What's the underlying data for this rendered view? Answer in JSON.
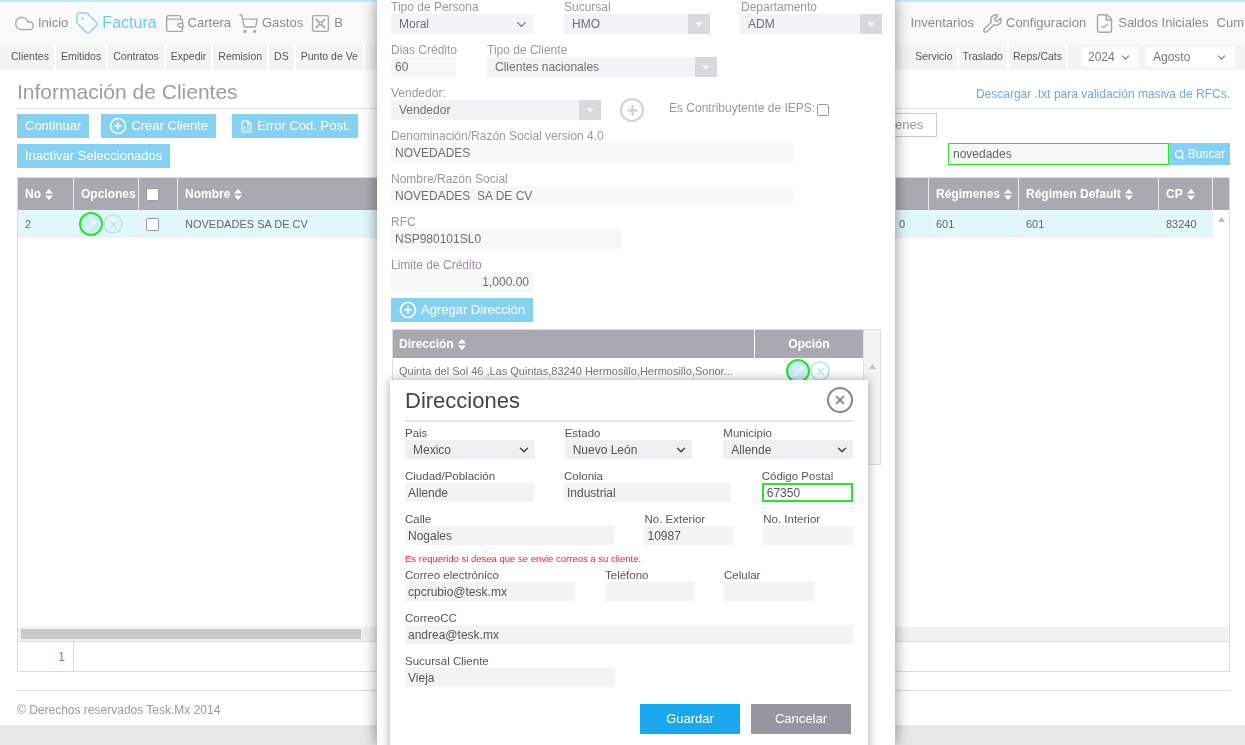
{
  "nav": {
    "left": [
      {
        "label": "Inicio",
        "selected": false
      },
      {
        "label": "Factura",
        "selected": true
      },
      {
        "label": "Cartera",
        "selected": false
      },
      {
        "label": "Gastos",
        "selected": false
      },
      {
        "label": "B",
        "selected": false
      }
    ],
    "right": [
      {
        "label": "Inventarios",
        "selected": false
      },
      {
        "label": "Configuracion",
        "selected": false
      },
      {
        "label": "Saldos Iniciales",
        "selected": false
      },
      {
        "label": "Cum",
        "selected": false
      }
    ]
  },
  "subnav": {
    "left": [
      "Clientes",
      "Emitidos",
      "Contratos",
      "Expedir",
      "Remision",
      "DS",
      "Punto de Ve"
    ],
    "right": [
      "Servicio",
      "Traslado",
      "Reps/Cats"
    ],
    "year": "2024",
    "month": "Agosto"
  },
  "page": {
    "title": "Información de Clientes",
    "download_link": "Descargar .txt para validación masiva de RFCs.",
    "buttons": [
      "Continuar",
      "Crear Cliente",
      "Error Cod. Post."
    ],
    "inactivate_button": "Inactivar Seleccionados",
    "filter_field": "enes",
    "search": {
      "value": "novedades",
      "button": "Buscar"
    }
  },
  "table": {
    "columns": [
      {
        "kind": "sort",
        "label": "No"
      },
      {
        "kind": "text",
        "label": "Opciones"
      },
      {
        "kind": "checkbox",
        "checked": false
      },
      {
        "kind": "sort",
        "label": "Nombre"
      },
      {
        "kind": "hidden"
      },
      {
        "kind": "sort",
        "label": "Régimenes"
      },
      {
        "kind": "sort",
        "label": "Régimen Default"
      },
      {
        "kind": "sort",
        "label": "CP"
      }
    ],
    "rows": [
      {
        "selected": true,
        "no": "2",
        "checked": false,
        "nombre": "NOVEDADES SA DE CV",
        "column_5": "0",
        "regimenes": "601",
        "regimen_default": "601",
        "cp": "83240"
      }
    ],
    "pager": "1"
  },
  "footer": "© Derechos reservados Tesk.Mx 2014",
  "client_form": {
    "row1": [
      {
        "label": "Tipo de Persona",
        "value": "Moral",
        "disabled": false
      },
      {
        "label": "Sucursal",
        "value": "HMO",
        "disabled": true
      },
      {
        "label": "Departamento",
        "value": "ADM",
        "disabled": true
      }
    ],
    "dias_credito": {
      "label": "Dias Crédito",
      "value": "60"
    },
    "tipo_cliente": {
      "label": "Tipo de Cliente",
      "value": "Clientes nacionales",
      "disabled": true
    },
    "vendedor": {
      "label": "Vendedor:",
      "value": "Vendedor",
      "disabled": true
    },
    "ieps": {
      "label": "Es Contribuytente de IEPS:",
      "checked": false
    },
    "fields": [
      {
        "label": "Denominación/Razón Social version 4.0",
        "value": "NOVEDADES"
      },
      {
        "label": "Nombre/Razón Social",
        "value": "NOVEDADES  SA DE CV"
      },
      {
        "label": "RFC",
        "value": "NSP980101SL0"
      }
    ],
    "credit": {
      "label": "Limite de Crédito",
      "value": "1,000.00"
    },
    "add_button": "Agregar Dirección",
    "addresses": {
      "columns": [
        "Dirección",
        "Opción"
      ],
      "rows": [
        {
          "text": "Quinta del Sol 46 ,Las Quintas,83240 Hermosillo,Hermosillo,Sonor..."
        }
      ]
    }
  },
  "address_dialog": {
    "title": "Direcciones",
    "rows": [
      [
        {
          "kind": "select",
          "label": "Pais",
          "value": "Mexico",
          "focused": false
        },
        {
          "kind": "select",
          "label": "Estado",
          "value": "Nuevo León",
          "focused": false
        },
        {
          "kind": "select",
          "label": "Municipio",
          "value": "Allende",
          "focused": false
        }
      ],
      [
        {
          "kind": "input",
          "label": "Ciudad/Población",
          "value": "Allende",
          "focused": false
        },
        {
          "kind": "input",
          "label": "Colonia",
          "value": "Industrial",
          "focused": false
        },
        {
          "kind": "input",
          "label": "Código Postal",
          "value": "67350",
          "focused": true
        }
      ],
      [
        {
          "kind": "input",
          "label": "Calle",
          "value": "Nogales",
          "focused": false
        },
        {
          "kind": "input",
          "label": "No. Exterior",
          "value": "10987",
          "focused": false
        },
        {
          "kind": "input",
          "label": "No. Interior",
          "focused": false
        }
      ],
      [
        {
          "kind": "input",
          "label": "Correo electrónico",
          "value": "cpcrubio@tesk.mx",
          "focused": false
        },
        {
          "kind": "input",
          "label": "Teléfono",
          "focused": false
        },
        {
          "kind": "input",
          "label": "Celular",
          "focused": false
        }
      ],
      [
        {
          "kind": "input",
          "label": "CorreoCC",
          "value": "andrea@tesk.mx",
          "focused": false
        }
      ],
      [
        {
          "kind": "input",
          "label": "Sucursal Cliente",
          "value": "Vieja",
          "focused": false
        }
      ]
    ],
    "note": "Es requerido si desea que se envie correos a su cliente.",
    "buttons": [
      {
        "kind": "primary",
        "label": "Guardar"
      },
      {
        "kind": "secondary",
        "label": "Cancelar"
      }
    ]
  }
}
